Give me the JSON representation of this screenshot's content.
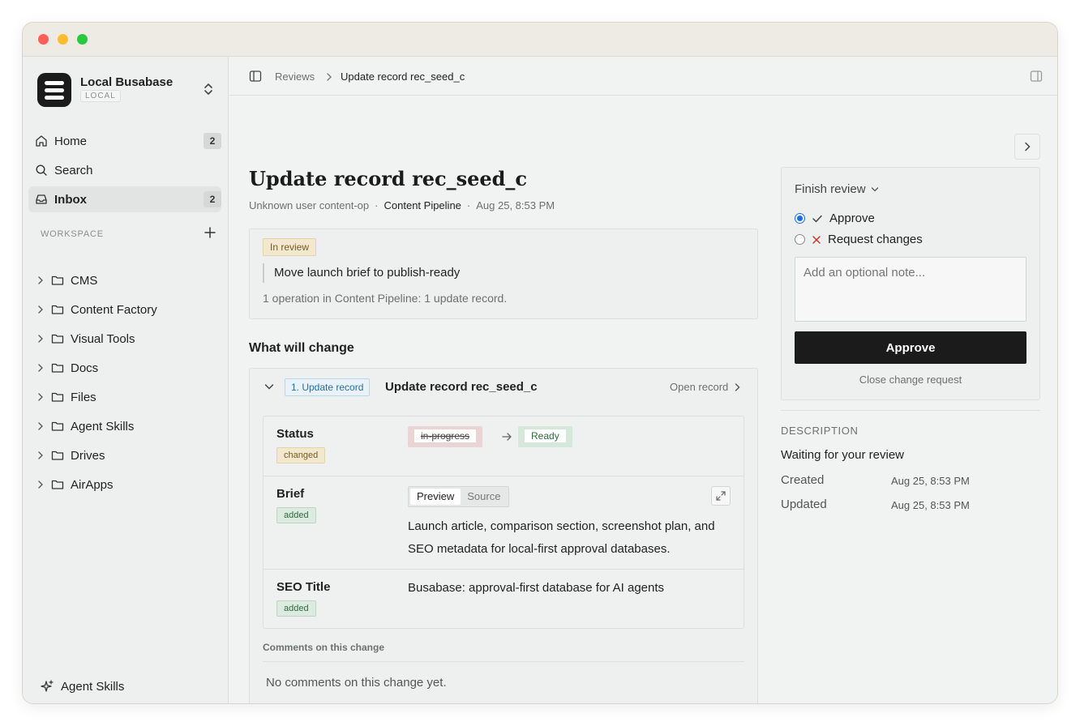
{
  "workspace": {
    "name": "Local Busabase",
    "badge": "LOCAL"
  },
  "nav": [
    {
      "label": "Home",
      "icon": "home-icon",
      "count": "2"
    },
    {
      "label": "Search",
      "icon": "search-icon"
    },
    {
      "label": "Inbox",
      "icon": "inbox-icon",
      "count": "2",
      "active": true
    }
  ],
  "workspace_section": {
    "label": "WORKSPACE"
  },
  "folders": [
    "CMS",
    "Content Factory",
    "Visual Tools",
    "Docs",
    "Files",
    "Agent Skills",
    "Drives",
    "AirApps"
  ],
  "sidebar_footer": {
    "label": "Agent Skills",
    "icon": "sparkle-icon"
  },
  "breadcrumb": {
    "parent": "Reviews",
    "current": "Update record rec_seed_c"
  },
  "page": {
    "title": "Update record rec_seed_c",
    "meta_user": "Unknown user content-op",
    "meta_pipeline": "Content Pipeline",
    "meta_time": "Aug 25, 8:53 PM",
    "meta_sep": "·"
  },
  "summary": {
    "status": "In review",
    "quote": "Move launch brief to publish-ready",
    "line": "1 operation in Content Pipeline: 1 update record."
  },
  "changes": {
    "heading": "What will change",
    "op_tag": "1. Update record",
    "op_title": "Update record rec_seed_c",
    "open_record": "Open record",
    "fields": {
      "status": {
        "name": "Status",
        "badge": "changed",
        "old": "in-progress",
        "new": "Ready"
      },
      "brief": {
        "name": "Brief",
        "badge": "added",
        "tab_preview": "Preview",
        "tab_source": "Source",
        "text": "Launch article, comparison section, screenshot plan, and SEO metadata for local-first approval databases."
      },
      "seo": {
        "name": "SEO Title",
        "badge": "added",
        "text": "Busabase: approval-first database for AI agents"
      }
    },
    "comments_label": "Comments on this change",
    "comments_empty": "No comments on this change yet."
  },
  "review": {
    "finish_label": "Finish review",
    "approve_option": "Approve",
    "changes_option": "Request changes",
    "note_placeholder": "Add an optional note...",
    "approve_button": "Approve",
    "close_request": "Close change request"
  },
  "details": {
    "label": "DESCRIPTION",
    "description": "Waiting for your review",
    "created_key": "Created",
    "created_val": "Aug 25, 8:53 PM",
    "updated_key": "Updated",
    "updated_val": "Aug 25, 8:53 PM"
  },
  "colors": {
    "accent": "#1a6fe0",
    "primary_button": "#1b1b1b",
    "changed": "#f2e8cf",
    "added": "#dceadf"
  }
}
